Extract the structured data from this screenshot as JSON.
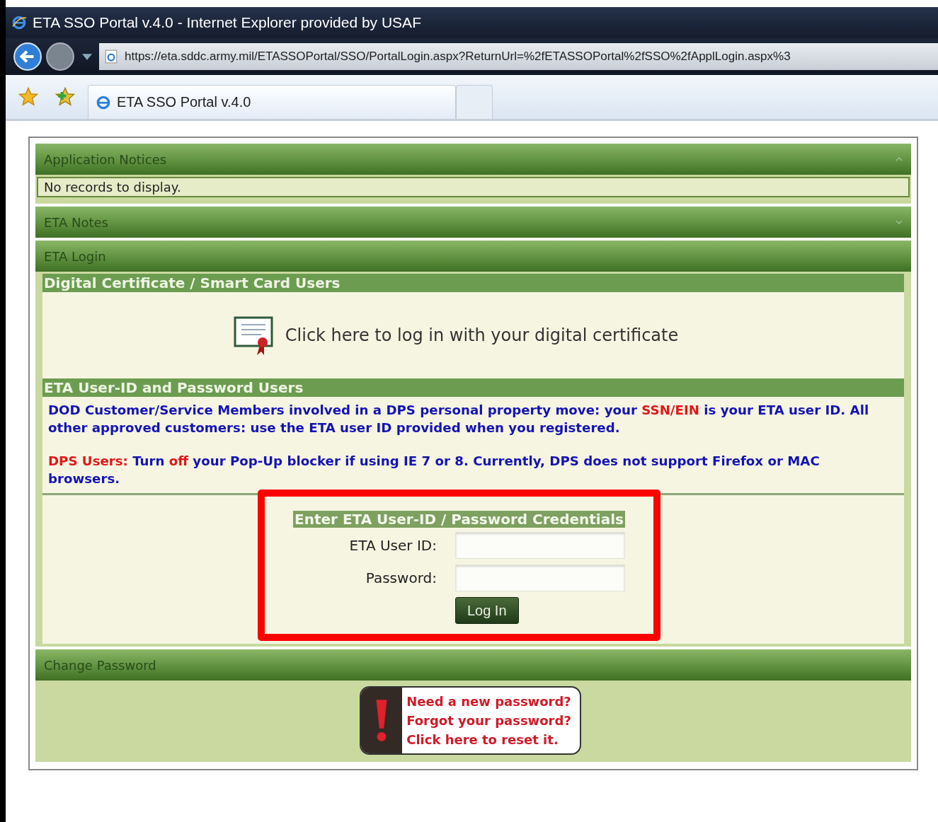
{
  "window": {
    "title": "ETA SSO Portal v.4.0 - Internet Explorer provided by USAF"
  },
  "address_bar": {
    "url": "https://eta.sddc.army.mil/ETASSOPortal/SSO/PortalLogin.aspx?ReturnUrl=%2fETASSOPortal%2fSSO%2fApplLogin.aspx%3"
  },
  "tabs": [
    {
      "label": "ETA SSO Portal v.4.0",
      "selected": true
    }
  ],
  "notices": {
    "title": "Application Notices",
    "expanded": true,
    "message": "No records to display."
  },
  "notes": {
    "title": "ETA Notes",
    "expanded": false
  },
  "login": {
    "title": "ETA Login",
    "certificate": {
      "heading": "Digital Certificate / Smart Card Users",
      "link": "Click here to log in with your digital certificate"
    },
    "password_users": {
      "heading": "ETA User-ID and Password Users",
      "paragraphs": [
        [
          {
            "text": "DOD Customer/Service Members involved in a DPS personal property move: your ",
            "alert": false
          },
          {
            "text": "SSN/EIN",
            "alert": true
          },
          {
            "text": " is your ETA user ID. All other approved customers: use the ETA user ID provided when you registered.",
            "alert": false
          }
        ],
        [
          {
            "text": "DPS Users:",
            "alert": true
          },
          {
            "text": " Turn ",
            "alert": false
          },
          {
            "text": "off",
            "alert": true
          },
          {
            "text": " your Pop-Up blocker if using IE 7 or 8. Currently, DPS does not support Firefox or MAC browsers.",
            "alert": false
          }
        ]
      ]
    },
    "credentials": {
      "heading": "Enter ETA User-ID / Password Credentials",
      "highlighted": true,
      "fields": [
        {
          "label": "ETA User ID:"
        },
        {
          "label": "Password:"
        }
      ],
      "button": "Log In"
    }
  },
  "change_password": {
    "title": "Change Password",
    "reset_link": [
      "Need a new password?",
      "Forgot your password?",
      "Click here to reset it."
    ]
  }
}
